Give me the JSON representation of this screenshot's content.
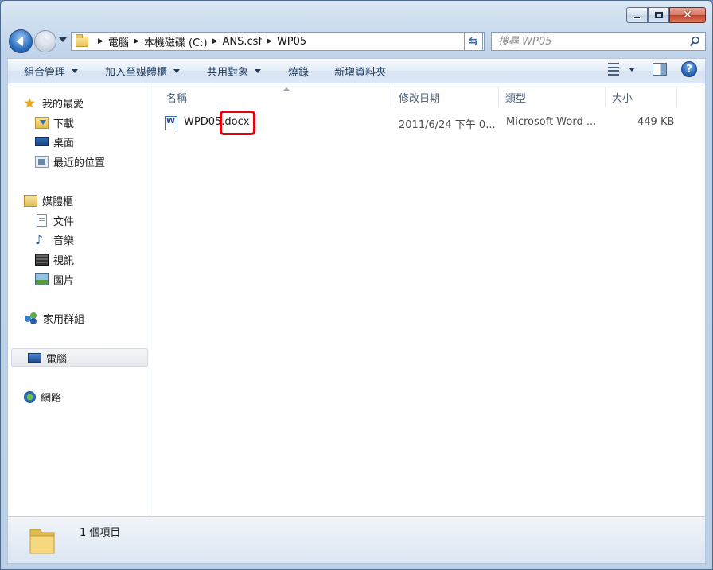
{
  "window": {
    "caption": {
      "close_glyph": "✕"
    }
  },
  "address": {
    "crumbs": [
      "電腦",
      "本機磁碟 (C:)",
      "ANS.csf",
      "WP05"
    ]
  },
  "search": {
    "placeholder": "搜尋 WP05"
  },
  "toolbar": {
    "organize": "組合管理",
    "add_to_library": "加入至媒體櫃",
    "share_with": "共用對象",
    "burn": "燒錄",
    "new_folder": "新增資料夾",
    "help": "?"
  },
  "nav": {
    "favorites": "我的最愛",
    "downloads": "下載",
    "desktop": "桌面",
    "recent": "最近的位置",
    "libraries": "媒體櫃",
    "documents": "文件",
    "music": "音樂",
    "videos": "視訊",
    "pictures": "圖片",
    "homegroup": "家用群組",
    "computer": "電腦",
    "network": "網路"
  },
  "columns": {
    "name": "名稱",
    "date": "修改日期",
    "type": "類型",
    "size": "大小"
  },
  "files": [
    {
      "name": "WPD05.docx",
      "date": "2011/6/24 下午 0...",
      "type": "Microsoft Word ...",
      "size": "449 KB"
    }
  ],
  "status": {
    "item_count": "1 個項目"
  },
  "colors": {
    "highlight": "#e8000a",
    "accent": "#2b6fc2"
  }
}
